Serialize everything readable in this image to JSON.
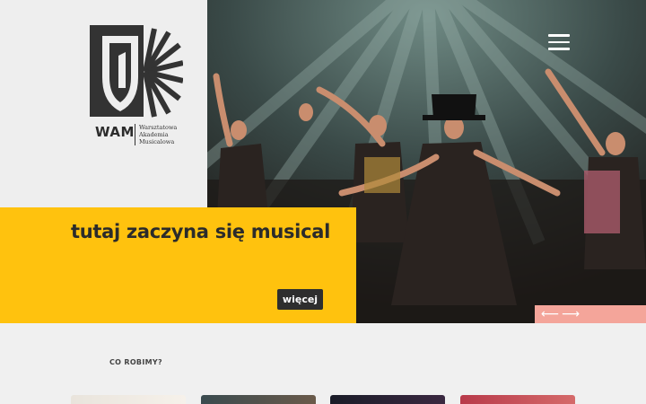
{
  "brand": {
    "short": "WAM",
    "full_line1": "Warsztatowa",
    "full_line2": "Akademia",
    "full_line3": "Musicalowa"
  },
  "hero": {
    "tagline": "tutaj zaczyna się musical",
    "more_label": "więcej",
    "prev_glyph": "⟵",
    "next_glyph": "⟶"
  },
  "nav": {
    "menu_icon": "hamburger-menu-icon"
  },
  "section": {
    "title": "CO ROBIMY?"
  },
  "colors": {
    "accent_yellow": "#ffc20e",
    "arrow_bg": "#f4a59a",
    "dark": "#2e2e2e"
  },
  "cards": [
    {
      "icon": "card-1-image"
    },
    {
      "icon": "card-2-image"
    },
    {
      "icon": "card-3-image"
    },
    {
      "icon": "card-4-image"
    }
  ]
}
